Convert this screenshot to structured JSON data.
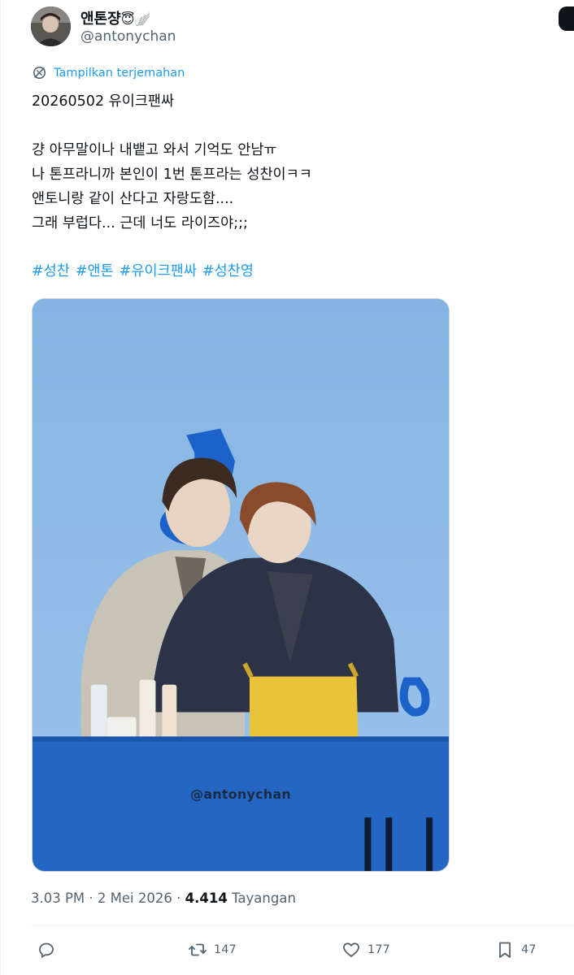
{
  "author": {
    "display_name": "앤톤쟝",
    "display_emoji": "😇🪽",
    "handle": "@antonychan"
  },
  "translate_label": "Tampilkan terjemahan",
  "tweet": {
    "lines": [
      "20260502 유이크팬싸",
      "",
      "걍 아무말이나 내뱉고 와서 기억도 안남ㅠ",
      "나 톤프라니까 본인이 1번 톤프라는 성찬이ㅋㅋ",
      "앤토니랑 같이 산다고 자랑도함....",
      "그래 부럽다... 근데 너도 라이즈야;;;"
    ],
    "hashtags": [
      "#성찬",
      "#앤톤",
      "#유이크팬싸",
      "#성찬영"
    ]
  },
  "media": {
    "watermark": "@antonychan"
  },
  "meta": {
    "time": "3.03 PM",
    "separator": "·",
    "date": "2 Mei 2026",
    "views_count": "4.414",
    "views_label": "Tayangan"
  },
  "actions": {
    "retweets": "147",
    "likes": "177",
    "bookmarks": "47"
  },
  "colors": {
    "accent": "#1d9bf0",
    "secondary_text": "#536471",
    "primary_text": "#0f1419"
  }
}
